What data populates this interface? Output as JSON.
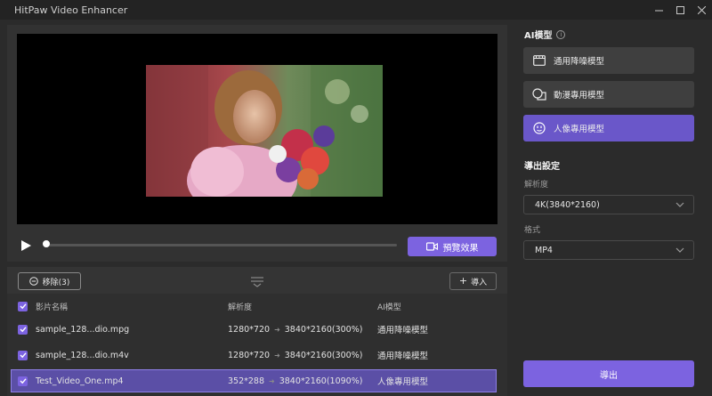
{
  "window": {
    "title": "HitPaw Video Enhancer",
    "controls": [
      "minimize",
      "maximize",
      "close"
    ]
  },
  "player": {
    "progress": 0.0,
    "preview_label": "預覽效果"
  },
  "list_toolbar": {
    "remove_label": "移除(3)",
    "import_label": "導入"
  },
  "table": {
    "columns": [
      "影片名稱",
      "解析度",
      "AI模型"
    ],
    "rows": [
      {
        "name": "sample_128...dio.mpg",
        "from": "1280*720",
        "to": "3840*2160(300%)",
        "model": "通用降噪模型",
        "checked": true,
        "selected": false
      },
      {
        "name": "sample_128...dio.m4v",
        "from": "1280*720",
        "to": "3840*2160(300%)",
        "model": "通用降噪模型",
        "checked": true,
        "selected": false
      },
      {
        "name": "Test_Video_One.mp4",
        "from": "352*288",
        "to": "3840*2160(1090%)",
        "model": "人像專用模型",
        "checked": true,
        "selected": true
      }
    ]
  },
  "ai_panel": {
    "title": "AI模型",
    "models": [
      {
        "label": "通用降噪模型",
        "icon": "film-icon",
        "active": false
      },
      {
        "label": "動漫專用模型",
        "icon": "shapes-icon",
        "active": false
      },
      {
        "label": "人像專用模型",
        "icon": "face-icon",
        "active": true
      }
    ]
  },
  "export_settings": {
    "title": "導出設定",
    "resolution_label": "解析度",
    "resolution_value": "4K(3840*2160)",
    "format_label": "格式",
    "format_value": "MP4",
    "export_label": "導出"
  },
  "colors": {
    "accent": "#7c63e0",
    "selected_row": "#5b4fa6",
    "background": "#2b2b2b"
  }
}
